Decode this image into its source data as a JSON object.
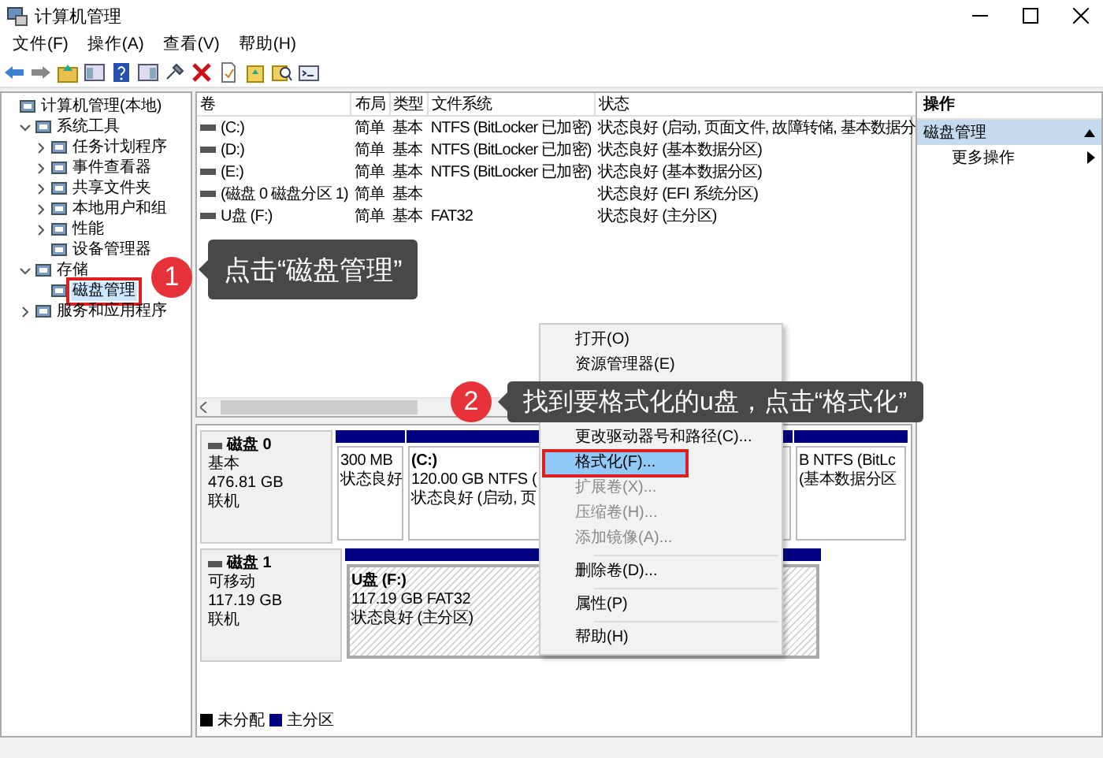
{
  "window": {
    "title": "计算机管理"
  },
  "menu_bar": [
    "文件(F)",
    "操作(A)",
    "查看(V)",
    "帮助(H)"
  ],
  "tree": [
    {
      "label": "计算机管理(本地)",
      "selected": false,
      "marked": false,
      "children": [
        {
          "label": "系统工具",
          "expanded": true,
          "selected": false,
          "marked": false,
          "children": [
            {
              "label": "任务计划程序",
              "expanded": false,
              "selected": false,
              "marked": false
            },
            {
              "label": "事件查看器",
              "expanded": false,
              "selected": false,
              "marked": false
            },
            {
              "label": "共享文件夹",
              "expanded": false,
              "selected": false,
              "marked": false
            },
            {
              "label": "本地用户和组",
              "expanded": false,
              "selected": false,
              "marked": false
            },
            {
              "label": "性能",
              "expanded": false,
              "selected": false,
              "marked": false
            },
            {
              "label": "设备管理器",
              "selected": false,
              "marked": false
            }
          ]
        },
        {
          "label": "存储",
          "expanded": true,
          "selected": false,
          "marked": false,
          "children": [
            {
              "label": "磁盘管理",
              "selected": true,
              "marked": true
            }
          ]
        },
        {
          "label": "服务和应用程序",
          "expanded": false,
          "selected": false,
          "marked": false
        }
      ]
    }
  ],
  "volume_table": {
    "columns": [
      "卷",
      "布局",
      "类型",
      "文件系统",
      "状态"
    ],
    "rows": [
      [
        "(C:)",
        "简单",
        "基本",
        "NTFS (BitLocker 已加密)",
        "状态良好 (启动, 页面文件, 故障转储, 基本数据分"
      ],
      [
        "(D:)",
        "简单",
        "基本",
        "NTFS (BitLocker 已加密)",
        "状态良好 (基本数据分区)"
      ],
      [
        "(E:)",
        "简单",
        "基本",
        "NTFS (BitLocker 已加密)",
        "状态良好 (基本数据分区)"
      ],
      [
        "(磁盘 0 磁盘分区 1)",
        "简单",
        "基本",
        "",
        "状态良好 (EFI 系统分区)"
      ],
      [
        "U盘 (F:)",
        "简单",
        "基本",
        "FAT32",
        "状态良好 (主分区)"
      ]
    ]
  },
  "disks": [
    {
      "name": "磁盘 0",
      "type": "基本",
      "size": "476.81 GB",
      "status": "联机",
      "partitions": [
        {
          "lines": [
            "300 MB",
            "状态良好"
          ],
          "selected": false
        },
        {
          "title": "(C:)",
          "lines": [
            "120.00 GB NTFS (",
            "状态良好 (启动, 页"
          ],
          "selected": false
        },
        {
          "lines": [
            "B NTFS (BitLc",
            "(基本数据分区"
          ],
          "selected": false
        }
      ]
    },
    {
      "name": "磁盘 1",
      "type": "可移动",
      "size": "117.19 GB",
      "status": "联机",
      "partitions": [
        {
          "title": "U盘 (F:)",
          "lines": [
            "117.19 GB FAT32",
            "状态良好 (主分区)"
          ],
          "selected": true
        }
      ]
    }
  ],
  "legend": [
    {
      "label": "未分配",
      "color": "#000000"
    },
    {
      "label": "主分区",
      "color": "#000080"
    }
  ],
  "actions": {
    "title": "操作",
    "section": "磁盘管理",
    "items": [
      "更多操作"
    ]
  },
  "context_menu": [
    {
      "label": "打开(O)",
      "disabled": false,
      "selected": false,
      "marked": false
    },
    {
      "label": "资源管理器(E)",
      "disabled": false,
      "selected": false,
      "marked": false
    },
    {
      "label": "更改驱动器号和路径(C)...",
      "disabled": false,
      "selected": false,
      "marked": false
    },
    {
      "label": "格式化(F)...",
      "disabled": false,
      "selected": true,
      "marked": true
    },
    {
      "label": "扩展卷(X)...",
      "disabled": true,
      "selected": false,
      "marked": false
    },
    {
      "label": "压缩卷(H)...",
      "disabled": true,
      "selected": false,
      "marked": false
    },
    {
      "label": "添加镜像(A)...",
      "disabled": true,
      "selected": false,
      "marked": false
    },
    {
      "label": "删除卷(D)...",
      "disabled": false,
      "selected": false,
      "marked": false
    },
    {
      "label": "属性(P)",
      "disabled": false,
      "selected": false,
      "marked": false
    },
    {
      "label": "帮助(H)",
      "disabled": false,
      "selected": false,
      "marked": false
    }
  ],
  "annotations": [
    {
      "number": "1",
      "text": "点击“磁盘管理”"
    },
    {
      "number": "2",
      "text": "找到要格式化的u盘，点击“格式化”"
    }
  ]
}
